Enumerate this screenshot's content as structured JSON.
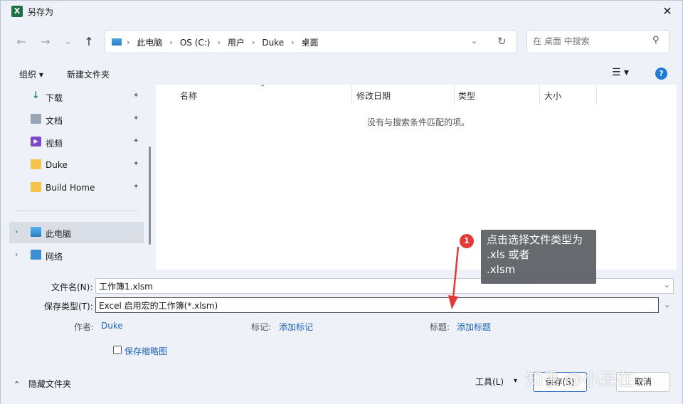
{
  "titlebar": {
    "app_icon_text": "X",
    "title": "另存为",
    "close_glyph": "✕"
  },
  "nav": {
    "back_glyph": "←",
    "forward_glyph": "→",
    "recent_glyph": "⌄",
    "up_glyph": "↑",
    "breadcrumbs": [
      "此电脑",
      "OS (C:)",
      "用户",
      "Duke",
      "桌面"
    ],
    "crumb_sep": "›",
    "dropdown_glyph": "⌄",
    "refresh_glyph": "↻"
  },
  "search": {
    "placeholder": "在 桌面 中搜索",
    "icon_glyph": "⚲"
  },
  "toolbar": {
    "organize_label": "组织 ▾",
    "new_folder_label": "新建文件夹",
    "view_glyph": "☰ ▾",
    "help_glyph": "?"
  },
  "sidebar": {
    "items": [
      {
        "label": "下载",
        "icon": "download-icon",
        "glyph": "↓",
        "pinned": true
      },
      {
        "label": "文档",
        "icon": "document-icon",
        "glyph": "",
        "pinned": true
      },
      {
        "label": "视频",
        "icon": "video-icon",
        "glyph": "▶",
        "pinned": true
      },
      {
        "label": "Duke",
        "icon": "folder-icon",
        "glyph": "",
        "pinned": true
      },
      {
        "label": "Build Home",
        "icon": "folder-icon",
        "glyph": "",
        "pinned": true
      },
      {
        "label": "此电脑",
        "icon": "computer-icon",
        "glyph": "",
        "selected": true,
        "expand_glyph": "›"
      },
      {
        "label": "网络",
        "icon": "network-icon",
        "glyph": "",
        "expand_glyph": "›"
      }
    ],
    "pin_glyph": "📌"
  },
  "filelist": {
    "columns": [
      "名称",
      "修改日期",
      "类型",
      "大小"
    ],
    "sort_glyph": "⌃",
    "empty_message": "没有与搜索条件匹配的项。"
  },
  "form": {
    "filename_label": "文件名(N):",
    "filename_value": "工作簿1.xlsm",
    "filetype_label": "保存类型(T):",
    "filetype_value": "Excel 启用宏的工作簿(*.xlsm)",
    "dropdown_glyph": "⌄",
    "author_label": "作者:",
    "author_value": "Duke",
    "tags_label": "标记:",
    "tags_value": "添加标记",
    "title_label": "标题:",
    "title_value": "添加标题",
    "thumbnail_label": "保存缩略图"
  },
  "footer": {
    "hide_folders_label": "隐藏文件夹",
    "hide_folders_glyph": "⌃",
    "tools_label": "工具(L)",
    "tools_caret": "▾",
    "save_label": "保存(S)",
    "cancel_label": "取消"
  },
  "annotation": {
    "badge_number": "1",
    "callout_text": "点击选择文件类型为\n.xls  或者\n.xlsm"
  },
  "watermark": {
    "text": "知乎 @小王在"
  },
  "colors": {
    "accent": "#1f7bd8",
    "link": "#2266bb",
    "badge": "#e53935",
    "excel_green": "#1d7044"
  }
}
